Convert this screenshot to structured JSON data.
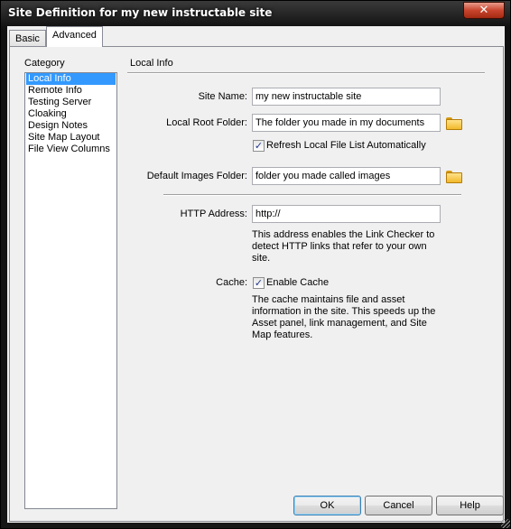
{
  "window": {
    "title": "Site Definition for my new instructable site",
    "close_glyph": "✕"
  },
  "tabs": [
    {
      "label": "Basic",
      "active": false
    },
    {
      "label": "Advanced",
      "active": true
    }
  ],
  "category": {
    "heading": "Category",
    "items": [
      {
        "label": "Local Info",
        "selected": true
      },
      {
        "label": "Remote Info"
      },
      {
        "label": "Testing Server"
      },
      {
        "label": "Cloaking"
      },
      {
        "label": "Design Notes"
      },
      {
        "label": "Site Map Layout"
      },
      {
        "label": "File View Columns"
      }
    ]
  },
  "local_info": {
    "heading": "Local Info",
    "site_name": {
      "label": "Site Name:",
      "value": "my new instructable site"
    },
    "local_root": {
      "label": "Local Root Folder:",
      "value": "The folder you made in my documents",
      "icon": "folder-icon"
    },
    "refresh": {
      "label": "Refresh Local File List Automatically",
      "checked": true
    },
    "default_images": {
      "label": "Default Images Folder:",
      "value": "folder you made called images",
      "icon": "folder-icon"
    },
    "http_address": {
      "label": "HTTP Address:",
      "value": "http://"
    },
    "http_desc": "This address enables the Link Checker to detect HTTP links that refer to your own site.",
    "cache": {
      "label": "Cache:",
      "checkbox_label": "Enable Cache",
      "checked": true
    },
    "cache_desc": "The cache maintains file and asset information in the site.  This speeds up the Asset panel, link management, and Site Map features."
  },
  "buttons": {
    "ok": "OK",
    "cancel": "Cancel",
    "help": "Help"
  },
  "colors": {
    "selection": "#3399ff",
    "close_button": "#c8442d"
  }
}
